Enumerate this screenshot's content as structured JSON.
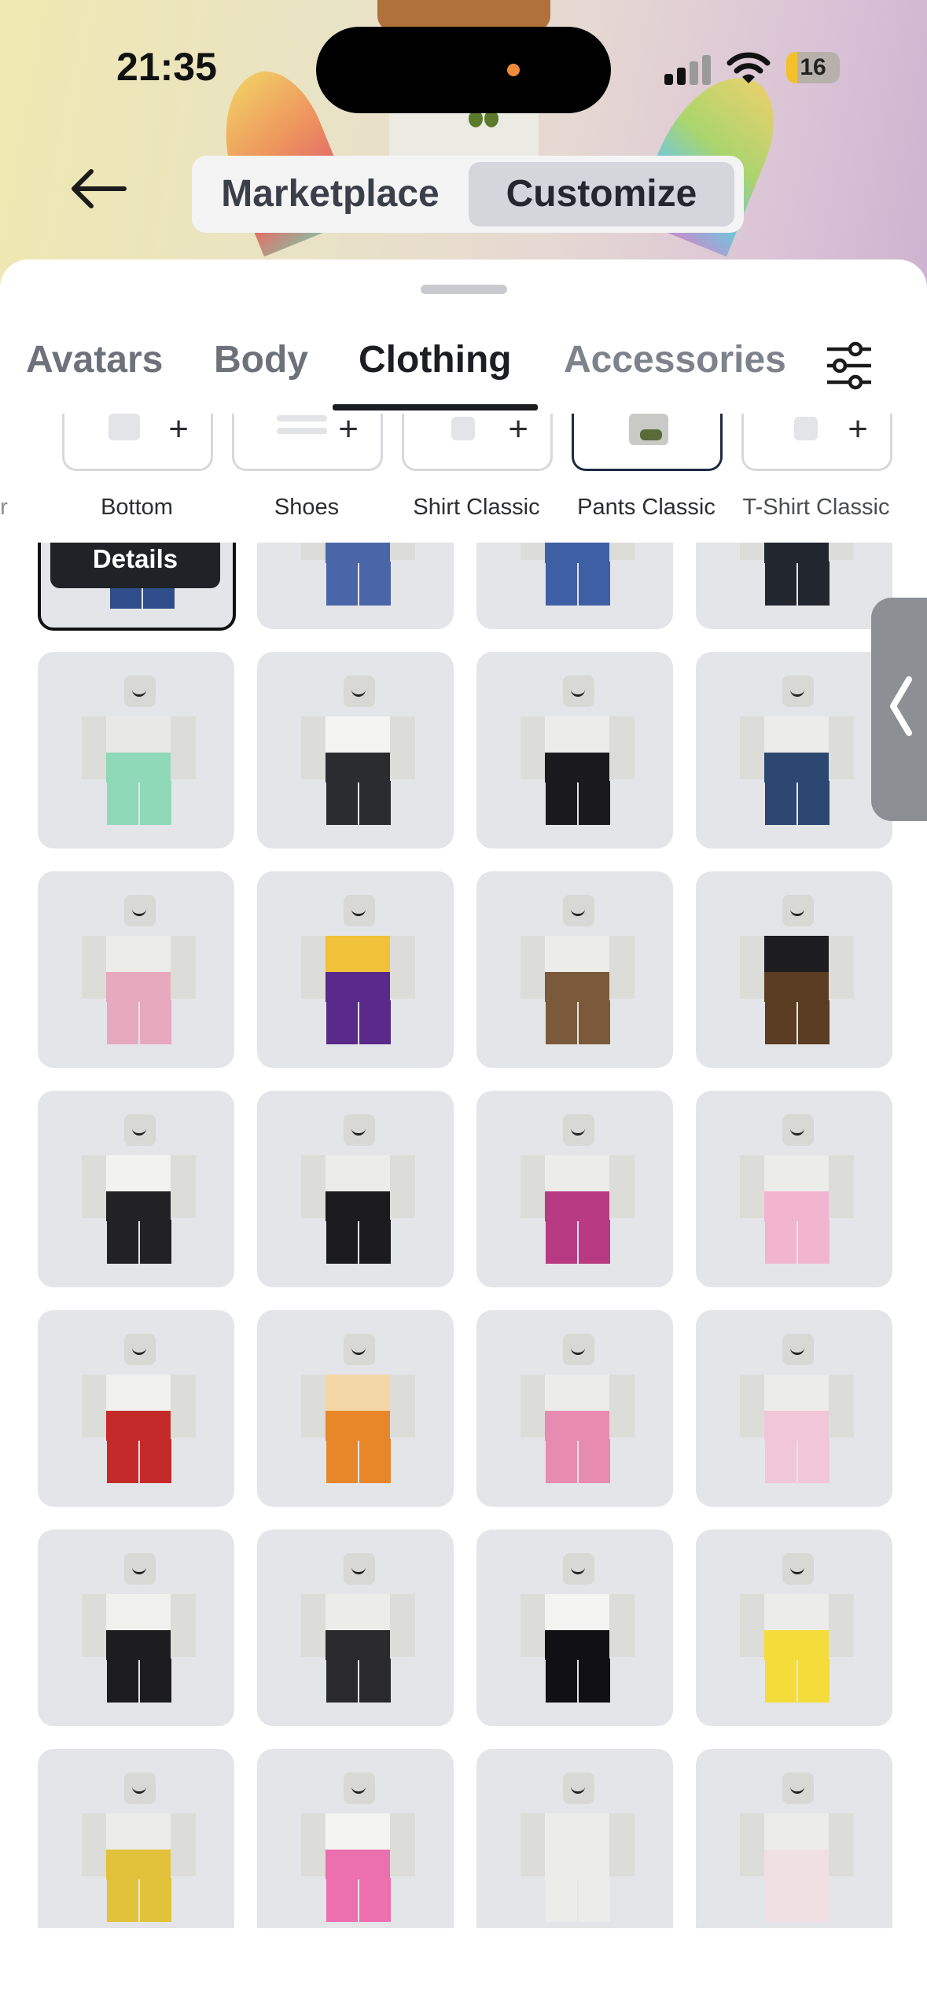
{
  "status_bar": {
    "time": "21:35",
    "battery": "16"
  },
  "header": {
    "segments": [
      {
        "label": "Marketplace",
        "active": false
      },
      {
        "label": "Customize",
        "active": true
      }
    ]
  },
  "tabs": [
    {
      "label": "Avatars",
      "active": false
    },
    {
      "label": "Body",
      "active": false
    },
    {
      "label": "Clothing",
      "active": true
    },
    {
      "label": "Accessories",
      "active": false
    }
  ],
  "categories": [
    {
      "label": "ar",
      "selected": false
    },
    {
      "label": "Bottom",
      "selected": false
    },
    {
      "label": "Shoes",
      "selected": false
    },
    {
      "label": "Shirt Classic",
      "selected": false
    },
    {
      "label": "Pants Classic",
      "selected": true
    },
    {
      "label": "T-Shirt Classic",
      "selected": false
    }
  ],
  "grid": {
    "details_label": "Details",
    "items": [
      {
        "color": "#2f4d8a",
        "accent": "#f0f0ee",
        "selected": true
      },
      {
        "color": "#4a66a8",
        "accent": "#c9828f"
      },
      {
        "color": "#3f5fa5",
        "accent": "#c78a96"
      },
      {
        "color": "#22272f",
        "accent": "#3a4a66"
      },
      {
        "color": "#8fd9b8",
        "accent": "#e8e8e6"
      },
      {
        "color": "#2a2c30",
        "accent": "#f4f4f2"
      },
      {
        "color": "#1a1a1c",
        "accent": "#ececea"
      },
      {
        "color": "#2c4770",
        "accent": "#ececea"
      },
      {
        "color": "#e7a9be",
        "accent": "#ececea"
      },
      {
        "color": "#5a2a8a",
        "accent": "#f2c13a"
      },
      {
        "color": "#7a5a3a",
        "accent": "#ececea"
      },
      {
        "color": "#5a3d22",
        "accent": "#1d1d1f"
      },
      {
        "color": "#222224",
        "accent": "#f2f2f0"
      },
      {
        "color": "#1b1b1d",
        "accent": "#ececea"
      },
      {
        "color": "#b83a82",
        "accent": "#ececea"
      },
      {
        "color": "#f2b5d0",
        "accent": "#ececea"
      },
      {
        "color": "#c42a2a",
        "accent": "#f0f0ee"
      },
      {
        "color": "#e8862a",
        "accent": "#f3d7a6"
      },
      {
        "color": "#e88bb0",
        "accent": "#ececea"
      },
      {
        "color": "#f1c6d6",
        "accent": "#ececea"
      },
      {
        "color": "#1d1d1f",
        "accent": "#f0f0ee"
      },
      {
        "color": "#2a2a2c",
        "accent": "#ececea"
      },
      {
        "color": "#111113",
        "accent": "#f4f4f2"
      },
      {
        "color": "#f4dd3a",
        "accent": "#ececea"
      },
      {
        "color": "#e2c23a",
        "accent": "#ececea"
      },
      {
        "color": "#ec6fae",
        "accent": "#f4f4f2"
      },
      {
        "color": "#ececea",
        "accent": "#ececea"
      },
      {
        "color": "#f0e0e4",
        "accent": "#ececea"
      }
    ]
  }
}
